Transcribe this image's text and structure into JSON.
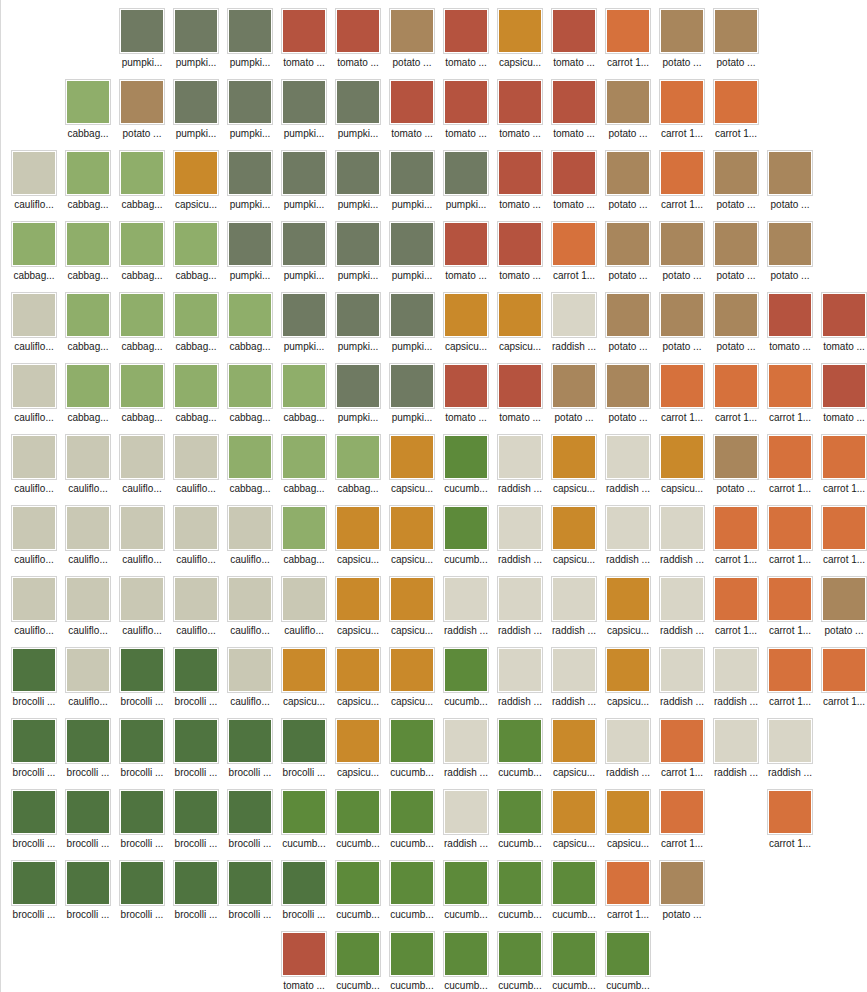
{
  "files": [
    [
      "pumpki...",
      "pumpki...",
      "pumpki...",
      "tomato ...",
      "tomato ...",
      "potato ...",
      "tomato ...",
      "capsicu...",
      "tomato ...",
      "carrot 1...",
      "potato ...",
      "potato ..."
    ],
    [
      "cabbag...",
      "potato ...",
      "pumpki...",
      "pumpki...",
      "pumpki...",
      "pumpki...",
      "tomato ...",
      "tomato ...",
      "tomato ...",
      "tomato ...",
      "potato ...",
      "carrot 1...",
      "carrot 1..."
    ],
    [
      "cauliflo...",
      "cabbag...",
      "cabbag...",
      "capsicu...",
      "pumpki...",
      "pumpki...",
      "pumpki...",
      "pumpki...",
      "pumpki...",
      "tomato ...",
      "tomato ...",
      "potato ...",
      "carrot 1...",
      "potato ...",
      "potato ..."
    ],
    [
      "cabbag...",
      "cabbag...",
      "cabbag...",
      "cabbag...",
      "pumpki...",
      "pumpki...",
      "pumpki...",
      "pumpki...",
      "tomato ...",
      "tomato ...",
      "carrot 1...",
      "potato ...",
      "potato ...",
      "potato ...",
      "potato ..."
    ],
    [
      "cauliflo...",
      "cabbag...",
      "cabbag...",
      "cabbag...",
      "cabbag...",
      "pumpki...",
      "pumpki...",
      "pumpki...",
      "capsicu...",
      "capsicu...",
      "raddish ...",
      "potato ...",
      "potato ...",
      "potato ...",
      "tomato ...",
      "tomato ..."
    ],
    [
      "cauliflo...",
      "cabbag...",
      "cabbag...",
      "cabbag...",
      "cabbag...",
      "cabbag...",
      "pumpki...",
      "pumpki...",
      "tomato ...",
      "tomato ...",
      "potato ...",
      "potato ...",
      "carrot 1...",
      "carrot 1...",
      "carrot 1...",
      "tomato ..."
    ],
    [
      "cauliflo...",
      "cauliflo...",
      "cauliflo...",
      "cauliflo...",
      "cabbag...",
      "cabbag...",
      "cabbag...",
      "capsicu...",
      "cucumb...",
      "raddish ...",
      "capsicu...",
      "raddish ...",
      "capsicu...",
      "potato ...",
      "carrot 1...",
      "carrot 1..."
    ],
    [
      "cauliflo...",
      "cauliflo...",
      "cauliflo...",
      "cauliflo...",
      "cauliflo...",
      "cabbag...",
      "capsicu...",
      "capsicu...",
      "cucumb...",
      "raddish ...",
      "capsicu...",
      "raddish ...",
      "raddish ...",
      "carrot 1...",
      "carrot 1...",
      "carrot 1..."
    ],
    [
      "cauliflo...",
      "cauliflo...",
      "cauliflo...",
      "cauliflo...",
      "cauliflo...",
      "cauliflo...",
      "capsicu...",
      "capsicu...",
      "raddish ...",
      "raddish ...",
      "raddish ...",
      "capsicu...",
      "raddish ...",
      "carrot 1...",
      "carrot 1...",
      "potato ..."
    ],
    [
      "brocolli ...",
      "cauliflo...",
      "brocolli ...",
      "brocolli ...",
      "cauliflo...",
      "capsicu...",
      "capsicu...",
      "capsicu...",
      "cucumb...",
      "raddish ...",
      "raddish ...",
      "capsicu...",
      "raddish ...",
      "raddish ...",
      "carrot 1...",
      "carrot 1..."
    ],
    [
      "brocolli ...",
      "brocolli ...",
      "brocolli ...",
      "brocolli ...",
      "brocolli ...",
      "brocolli ...",
      "capsicu...",
      "cucumb...",
      "raddish ...",
      "cucumb...",
      "capsicu...",
      "raddish ...",
      "carrot 1...",
      "raddish ...",
      "raddish ..."
    ],
    [
      "brocolli ...",
      "brocolli ...",
      "brocolli ...",
      "brocolli ...",
      "brocolli ...",
      "cucumb...",
      "cucumb...",
      "cucumb...",
      "raddish ...",
      "cucumb...",
      "capsicu...",
      "capsicu...",
      "carrot 1...",
      "carrot 1..."
    ],
    [
      "brocolli ...",
      "brocolli ...",
      "brocolli ...",
      "brocolli ...",
      "brocolli ...",
      "brocolli ...",
      "cucumb...",
      "cucumb...",
      "cucumb...",
      "cucumb...",
      "cucumb...",
      "carrot 1...",
      "potato ..."
    ],
    [
      "tomato ...",
      "cucumb...",
      "cucumb...",
      "cucumb...",
      "cucumb...",
      "cucumb...",
      "cucumb..."
    ]
  ]
}
